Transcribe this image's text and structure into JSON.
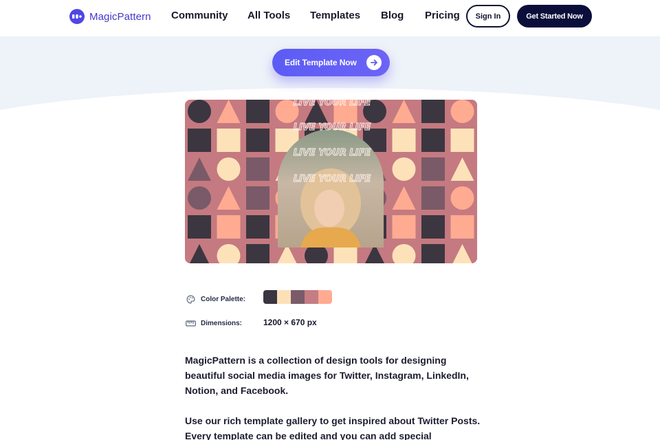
{
  "hero": {
    "ghost_text": ""
  },
  "nav": {
    "brand": "MagicPattern",
    "links": [
      "Community",
      "All Tools",
      "Templates",
      "Blog",
      "Pricing"
    ],
    "sign_in": "Sign In",
    "get_started": "Get Started Now"
  },
  "cta": {
    "label": "Edit Template Now"
  },
  "preview": {
    "headline_repeated": "LIVE YOUR LIFE",
    "colors": {
      "background": "#c47a80",
      "dark": "#3c3640",
      "cream": "#fde2b9",
      "mauve": "#7a5a68",
      "rose": "#c47a80",
      "peach": "#ffab91"
    }
  },
  "details": {
    "palette_label": "Color Palette:",
    "palette": [
      "#3a3540",
      "#fbe0b8",
      "#7b5b6a",
      "#c47d83",
      "#ffab91"
    ],
    "dimensions_label": "Dimensions:",
    "dimensions_value": "1200 × 670 px"
  },
  "description": {
    "p1": "MagicPattern is a collection of design tools for designing beautiful social media images for Twitter, Instagram, LinkedIn, Notion, and Facebook.",
    "p2": "Use our rich template gallery to get inspired about Twitter Posts. Every template can be edited and you can add special"
  }
}
